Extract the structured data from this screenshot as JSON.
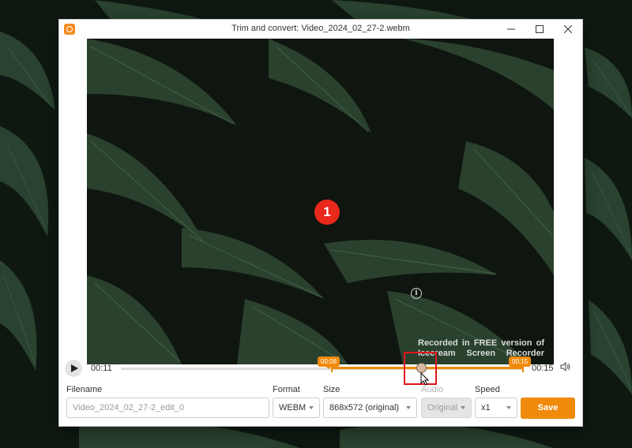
{
  "window": {
    "title": "Trim and convert: Video_2024_02_27-2.webm"
  },
  "video": {
    "step_badge": "1",
    "watermark_line1": "Recorded in FREE version of",
    "watermark_line2": "Icecream Screen Recorder"
  },
  "timeline": {
    "current_time": "00:11",
    "end_time": "00:15",
    "trim_start_marker": "00:08",
    "trim_end_marker": "00:15",
    "playhead_position": 0.73
  },
  "controls": {
    "filename_label": "Filename",
    "filename_placeholder": "Video_2024_02_27-2_edit_0",
    "format_label": "Format",
    "format_value": "WEBM",
    "size_label": "Size",
    "size_value": "868x572 (original)",
    "audio_label": "Audio",
    "audio_value": "Original",
    "speed_label": "Speed",
    "speed_value": "x1",
    "save_label": "Save"
  },
  "colors": {
    "accent": "#f08a0c",
    "badge": "#e8291c",
    "highlight": "#e0161b"
  },
  "icons": [
    "app-logo-icon",
    "minimize-icon",
    "maximize-icon",
    "close-icon",
    "play-icon",
    "volume-icon",
    "info-icon",
    "chevron-down-icon",
    "mouse-cursor-icon"
  ]
}
